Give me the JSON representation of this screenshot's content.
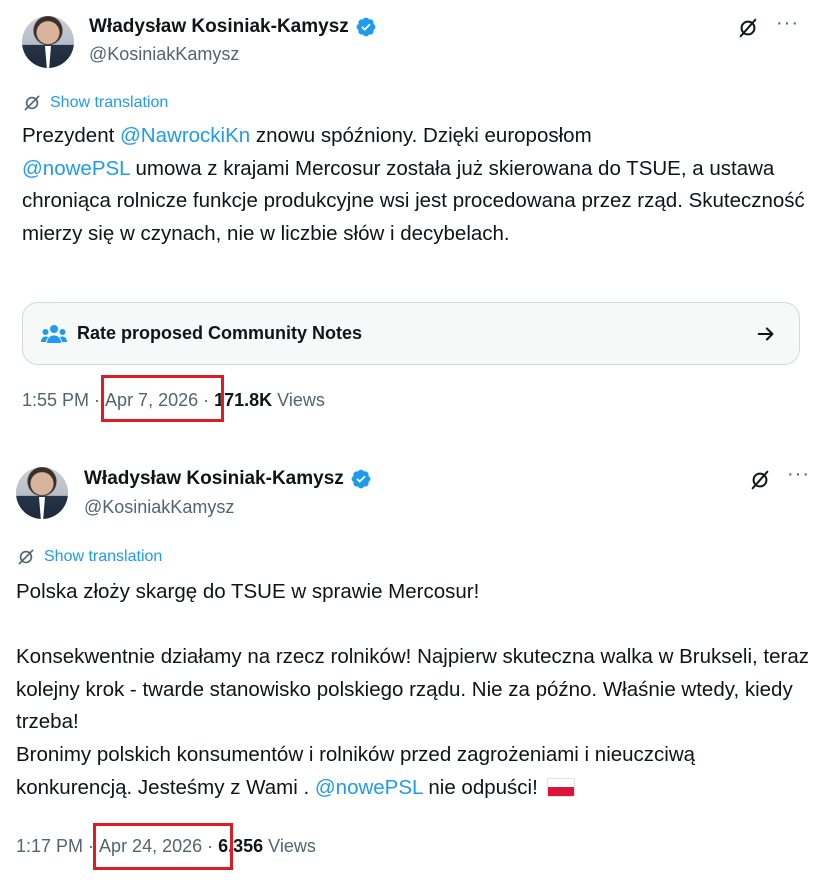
{
  "tweets": [
    {
      "author": {
        "name": "Władysław Kosiniak-Kamysz",
        "handle": "@KosiniakKamysz"
      },
      "translation_label": "Show translation",
      "text": {
        "p1_pre": "Prezydent ",
        "p1_mention": "@NawrockiKn",
        "p1_post": " znowu spóźniony. Dzięki europosłom ",
        "p2_mention": "@nowePSL",
        "p2_post": " umowa z krajami Mercosur została już skierowana do TSUE, a ustawa chroniąca rolnicze funkcje produkcyjne wsi jest procedowana przez rząd. Skuteczność mierzy się w czynach, nie w liczbie słów i decybelach."
      },
      "community_notes_label": "Rate proposed Community Notes",
      "meta": {
        "time": "1:55 PM",
        "sep1": " · ",
        "date": "Apr 7, 2026",
        "sep2": " · ",
        "views_count": "171.8K",
        "views_label": " Views"
      }
    },
    {
      "author": {
        "name": "Władysław Kosiniak-Kamysz",
        "handle": "@KosiniakKamysz"
      },
      "translation_label": "Show translation",
      "text": {
        "line1": "Polska złoży skargę do TSUE w sprawie Mercosur!",
        "para2": "Konsekwentnie działamy na rzecz rolników! Najpierw skuteczna walka w Brukseli, teraz kolejny krok - twarde stanowisko polskiego rządu. Nie za późno. Właśnie wtedy, kiedy trzeba!",
        "para3_pre": "Bronimy polskich konsumentów i rolników przed zagrożeniami i nieuczciwą konkurencją. Jesteśmy z Wami . ",
        "para3_mention": "@nowePSL",
        "para3_post": " nie odpuści! "
      },
      "meta": {
        "time": "1:17 PM",
        "sep1": " · ",
        "date": "Apr 24, 2026",
        "sep2": " · ",
        "views_count": "6,356",
        "views_label": " Views"
      }
    }
  ],
  "colors": {
    "accent": "#1d9bf0",
    "highlight": "#e01b24",
    "muted": "#536471",
    "text": "#0f1419"
  },
  "icons": [
    "verified-badge-icon",
    "grok-icon",
    "more-icon",
    "translate-icon",
    "community-notes-icon",
    "arrow-right-icon",
    "poland-flag-icon"
  ]
}
